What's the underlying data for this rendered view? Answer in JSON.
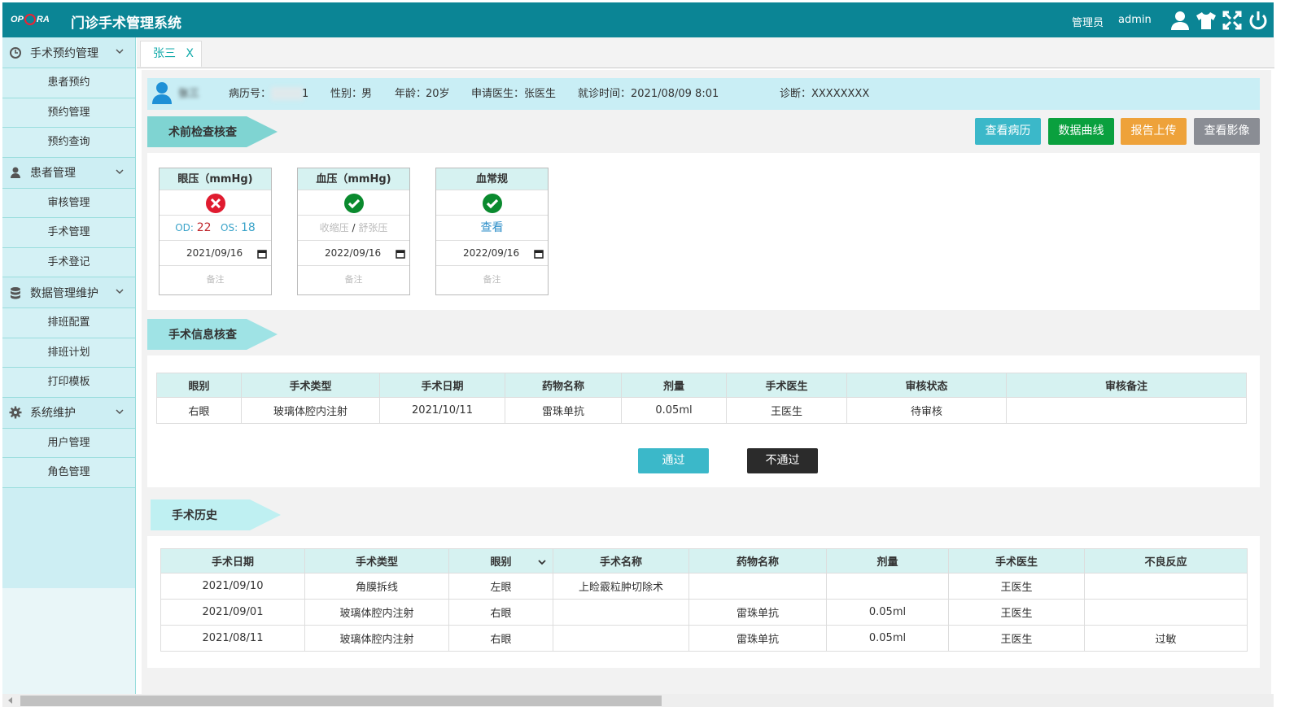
{
  "app": {
    "logo_text": "OPERA",
    "title": "门诊手术管理系统",
    "role": "管理员",
    "user": "admin"
  },
  "colors": {
    "primary": "#0b8595",
    "success": "#0aa03e",
    "warning": "#eea23a",
    "danger": "#e01b2f",
    "info": "#3bb8c9",
    "grey": "#8a8d94"
  },
  "sidebar": {
    "groups": [
      {
        "label": "手术预约管理",
        "icon": "clock-icon",
        "items": [
          "患者预约",
          "预约管理",
          "预约查询"
        ]
      },
      {
        "label": "患者管理",
        "icon": "user-icon",
        "items": [
          "审核管理",
          "手术管理",
          "手术登记"
        ]
      },
      {
        "label": "数据管理维护",
        "icon": "database-icon",
        "items": [
          "排班配置",
          "排班计划",
          "打印模板"
        ]
      },
      {
        "label": "系统维护",
        "icon": "gear-icon",
        "items": [
          "用户管理",
          "角色管理"
        ]
      }
    ]
  },
  "tabs": [
    {
      "label": "张三",
      "close": "X"
    }
  ],
  "patient": {
    "name": "张三",
    "record_label": "病历号：",
    "record_value": "1",
    "gender_label": "性别：",
    "gender": "男",
    "age_label": "年龄：",
    "age": "20岁",
    "doctor_label": "申请医生：",
    "doctor": "张医生",
    "visit_label": "就诊时间：",
    "visit_time": "2021/08/09  8:01",
    "diag_label": "诊断：",
    "diagnosis": "XXXXXXXX"
  },
  "sections": {
    "pre_check": "术前检查核查",
    "surgery_info": "手术信息核查",
    "history": "手术历史"
  },
  "actions": {
    "view_record": "查看病历",
    "data_curve": "数据曲线",
    "report_upload": "报告上传",
    "view_image": "查看影像"
  },
  "cards": [
    {
      "title": "眼压（mmHg)",
      "status": "fail",
      "od_label": "OD:",
      "od": "22",
      "os_label": "OS:",
      "os": "18",
      "date": "2021/09/16",
      "note": "备注"
    },
    {
      "title": "血压（mmHg)",
      "status": "pass",
      "systolic_placeholder": "收缩压",
      "sep": "/",
      "diastolic_placeholder": "舒张压",
      "date": "2022/09/16",
      "note": "备注"
    },
    {
      "title": "血常规",
      "status": "pass",
      "link": "查看",
      "date": "2022/09/16",
      "note": "备注"
    }
  ],
  "review_table": {
    "headers": [
      "眼别",
      "手术类型",
      "手术日期",
      "药物名称",
      "剂量",
      "手术医生",
      "审核状态",
      "审核备注"
    ],
    "rows": [
      [
        "右眼",
        "玻璃体腔内注射",
        "2021/10/11",
        "雷珠单抗",
        "0.05ml",
        "王医生",
        "待审核",
        ""
      ]
    ]
  },
  "review_buttons": {
    "pass": "通过",
    "reject": "不通过"
  },
  "history_table": {
    "headers": [
      "手术日期",
      "手术类型",
      "眼别",
      "手术名称",
      "药物名称",
      "剂量",
      "手术医生",
      "不良反应"
    ],
    "rows": [
      [
        "2021/09/10",
        "角膜拆线",
        "左眼",
        "上睑霰粒肿切除术",
        "",
        "",
        "王医生",
        ""
      ],
      [
        "2021/09/01",
        "玻璃体腔内注射",
        "右眼",
        "",
        "雷珠单抗",
        "0.05ml",
        "王医生",
        ""
      ],
      [
        "2021/08/11",
        "玻璃体腔内注射",
        "右眼",
        "",
        "雷珠单抗",
        "0.05ml",
        "王医生",
        "过敏"
      ]
    ]
  }
}
